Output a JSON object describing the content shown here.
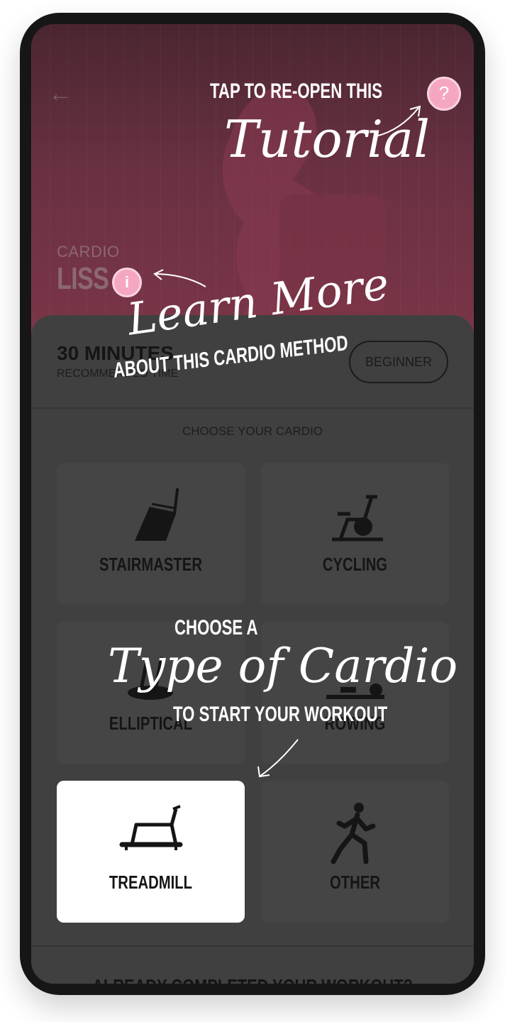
{
  "hero": {
    "cardio_type": "CARDIO",
    "cardio_method": "LISS",
    "info_icon": "i",
    "help_icon": "?"
  },
  "sheet": {
    "duration": "30 MINUTES",
    "duration_sub": "RECOMMENDED TIME",
    "level_button": "BEGINNER",
    "choose_label": "CHOOSE YOUR CARDIO",
    "tiles": [
      {
        "label": "STAIRMASTER",
        "icon": "stairmaster-icon",
        "selected": false
      },
      {
        "label": "CYCLING",
        "icon": "bike-icon",
        "selected": false
      },
      {
        "label": "ELLIPTICAL",
        "icon": "elliptical-icon",
        "selected": false
      },
      {
        "label": "ROWING",
        "icon": "rowing-icon",
        "selected": false
      },
      {
        "label": "TREADMILL",
        "icon": "treadmill-icon",
        "selected": true
      },
      {
        "label": "OTHER",
        "icon": "runner-icon",
        "selected": false
      }
    ],
    "completed_prompt": "ALREADY COMPLETED YOUR WORKOUT?"
  },
  "tutorial": {
    "tap_line": "TAP TO RE-OPEN THIS",
    "tutorial_script": "Tutorial",
    "learn_script": "Learn More",
    "learn_line": "ABOUT THIS CARDIO METHOD",
    "choose_line": "CHOOSE A",
    "type_script": "Type of Cardio",
    "start_line": "TO START YOUR WORKOUT"
  },
  "colors": {
    "accent_pink": "#f5a7c2",
    "overlay": "#3d3d3d",
    "selected_tile": "#ffffff"
  }
}
